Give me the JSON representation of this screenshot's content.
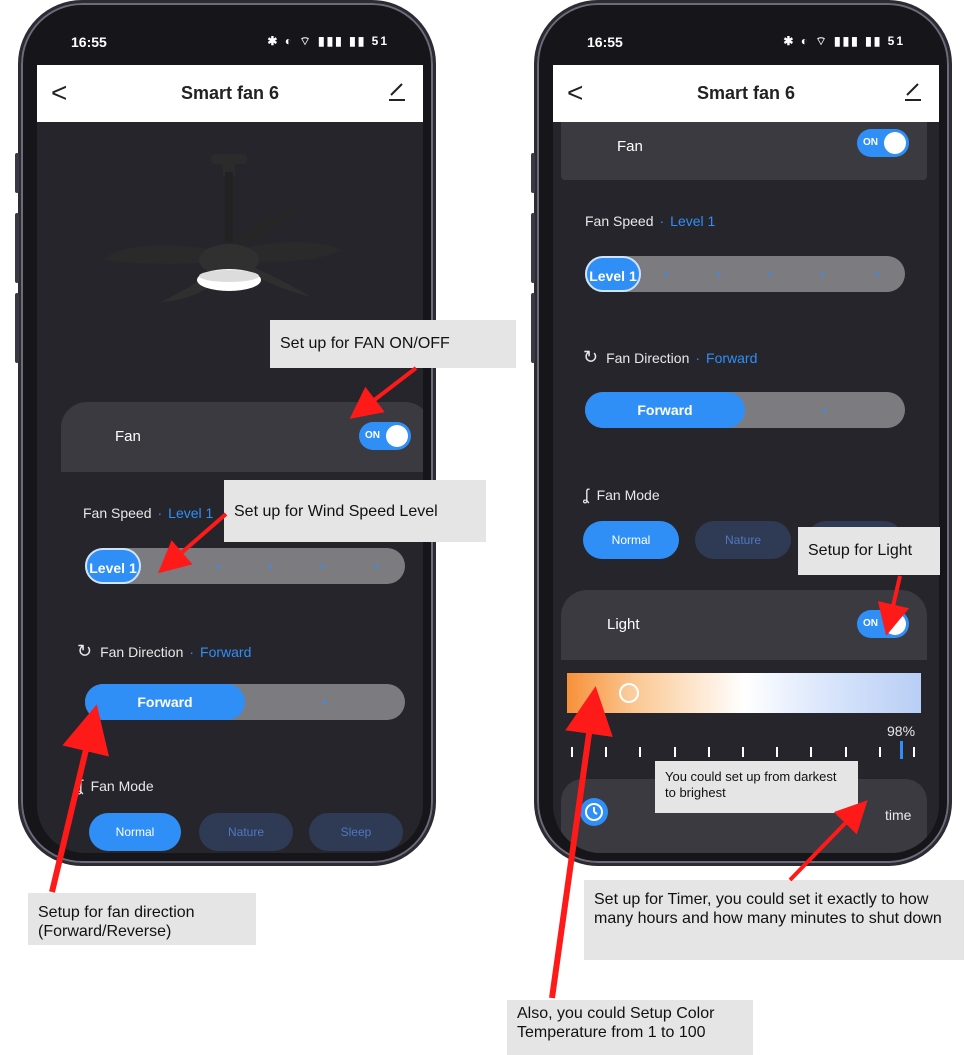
{
  "left_screen": {
    "status": {
      "time": "16:55",
      "icons": "✱ ◐ ⌔ ▮▮▮ ▮▮ 51"
    },
    "nav": {
      "back": "<",
      "title": "Smart fan 6"
    },
    "fan_card": {
      "label": "Fan",
      "toggle": "ON"
    },
    "fan_speed": {
      "label": "Fan Speed",
      "value": "Level 1",
      "thumb": "Level 1"
    },
    "fan_direction": {
      "label": "Fan Direction",
      "value": "Forward",
      "thumb": "Forward"
    },
    "fan_mode": {
      "label": "Fan Mode",
      "modes": [
        "Normal",
        "Nature",
        "Sleep"
      ],
      "active": "Normal"
    }
  },
  "right_screen": {
    "status": {
      "time": "16:55",
      "icons": "✱ ◐ ⌔ ▮▮▮ ▮▮ 51"
    },
    "nav": {
      "back": "<",
      "title": "Smart fan 6"
    },
    "fan_card": {
      "label": "Fan",
      "toggle": "ON"
    },
    "fan_speed": {
      "label": "Fan Speed",
      "value": "Level 1",
      "thumb": "Level 1"
    },
    "fan_direction": {
      "label": "Fan Direction",
      "value": "Forward",
      "thumb": "Forward"
    },
    "fan_mode": {
      "label": "Fan Mode",
      "modes": [
        "Normal",
        "Nature"
      ],
      "active": "Normal"
    },
    "light_card": {
      "label": "Light",
      "toggle": "ON"
    },
    "color_temp": {
      "percent_label": "98%",
      "level": 0.98
    },
    "timer": {
      "label": "time"
    }
  },
  "annotations": {
    "fan_onoff": "Set up for FAN ON/OFF",
    "wind_speed": "Set up for Wind Speed Level",
    "fan_direction": "Setup for fan direction (Forward/Reverse)",
    "light": "Setup for Light",
    "darkest": "You could set up from darkest to brighest",
    "timer": "Set up for Timer, you could set it exactly to how many hours and how many minutes to shut down",
    "color_temp": "Also, you could Setup Color Temperature from 1 to 100"
  },
  "colors": {
    "accent": "#2f8ff7",
    "arrow": "#ff1a1a",
    "card": "#3b3a40",
    "screen": "#26252c"
  }
}
